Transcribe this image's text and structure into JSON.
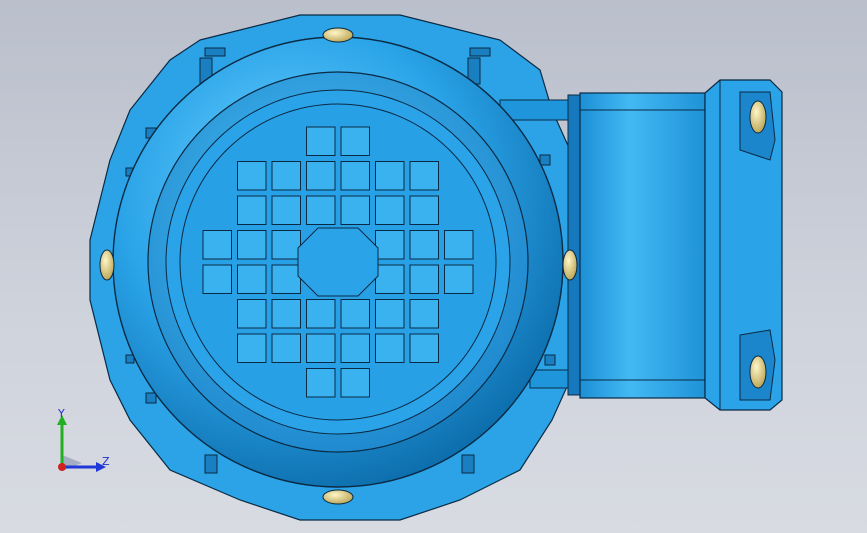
{
  "viewport": {
    "background": "#c8ccd6",
    "model": {
      "name": "motor-with-terminal-box",
      "body_color": "#2aa3e8",
      "edge_color": "#0a2a44",
      "bolt_color": "#e8d68c"
    }
  },
  "triad": {
    "y_label": "Y",
    "z_label": "Z",
    "y_color": "#22b022",
    "z_color": "#2038d8",
    "x_color": "#d02020"
  }
}
